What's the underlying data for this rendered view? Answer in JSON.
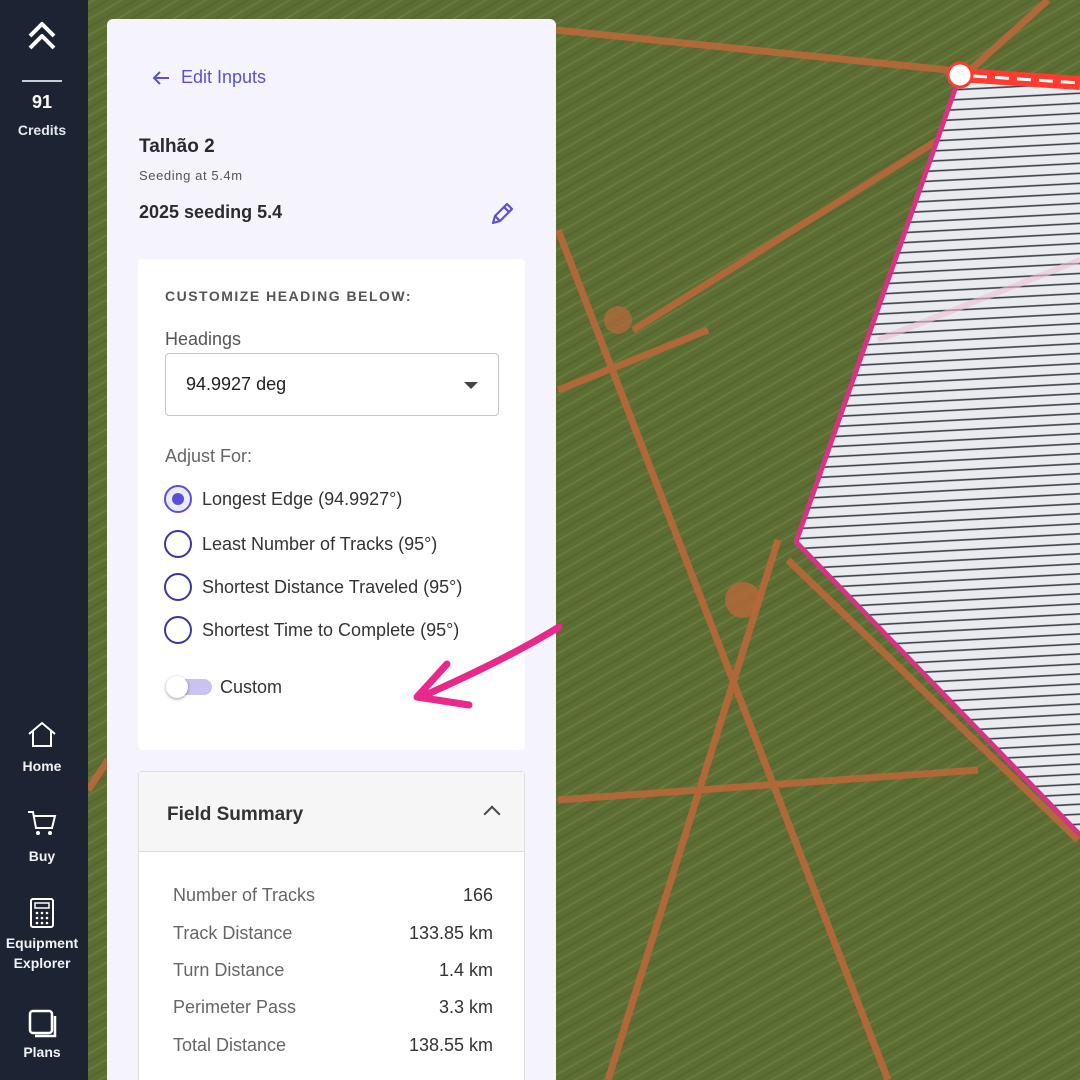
{
  "nav": {
    "credits_count": "91",
    "credits_label": "Credits",
    "items": [
      {
        "label": "Home",
        "icon": "home-icon"
      },
      {
        "label": "Buy",
        "icon": "cart-icon"
      },
      {
        "label": "Equipment Explorer",
        "icon": "calculator-icon"
      },
      {
        "label": "Plans",
        "icon": "plans-icon"
      }
    ]
  },
  "panel": {
    "back_label": "Edit Inputs",
    "field_name": "Talhão 2",
    "field_subtitle": "Seeding at 5.4m",
    "plan_name": "2025 seeding 5.4"
  },
  "heading_card": {
    "title": "CUSTOMIZE HEADING BELOW:",
    "headings_label": "Headings",
    "headings_value": "94.9927 deg",
    "adjust_label": "Adjust For:",
    "options": [
      {
        "label": "Longest Edge (94.9927°)",
        "checked": true
      },
      {
        "label": "Least Number of Tracks (95°)",
        "checked": false
      },
      {
        "label": "Shortest Distance Traveled (95°)",
        "checked": false
      },
      {
        "label": "Shortest Time to Complete (95°)",
        "checked": false
      }
    ],
    "custom_label": "Custom",
    "custom_on": false
  },
  "summary": {
    "title": "Field Summary",
    "rows": [
      {
        "label": "Number of Tracks",
        "value": "166"
      },
      {
        "label": "Track Distance",
        "value": "133.85 km"
      },
      {
        "label": "Turn Distance",
        "value": "1.4 km"
      },
      {
        "label": "Perimeter Pass",
        "value": "3.3 km"
      },
      {
        "label": "Total Distance",
        "value": "138.55 km"
      }
    ]
  },
  "colors": {
    "accent": "#5b4fd6",
    "nav_bg": "#1c2333",
    "annotation": "#e8288a",
    "field_boundary": "#d63384",
    "headland": "#ff3b2f"
  }
}
